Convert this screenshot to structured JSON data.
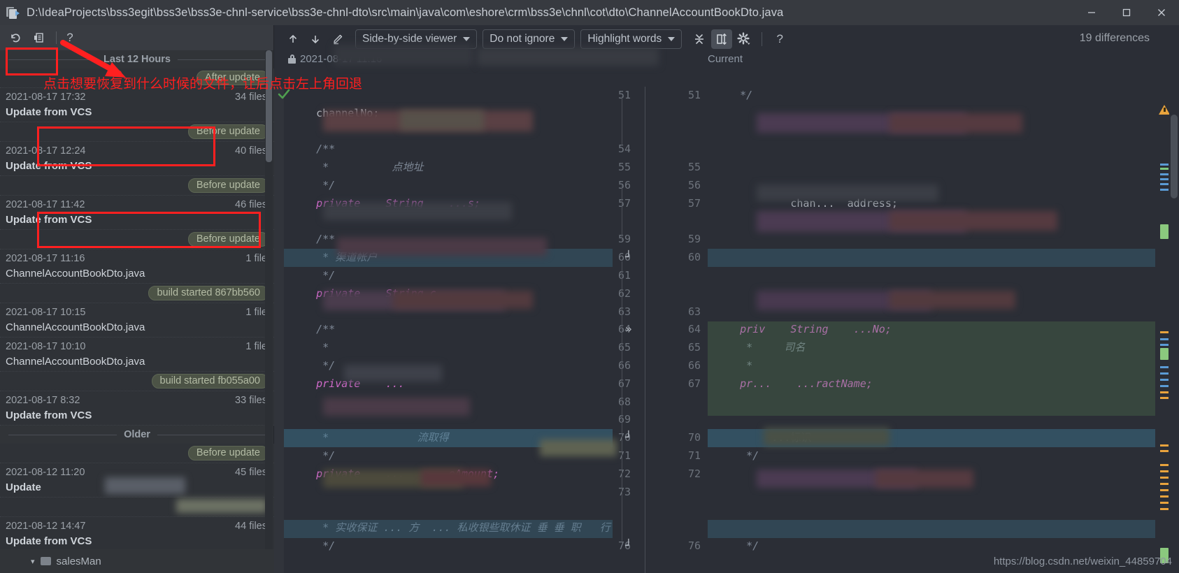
{
  "window": {
    "title": "D:\\IdeaProjects\\bss3egit\\bss3e\\bss3e-chnl-service\\bss3e-chnl-dto\\src\\main\\java\\com\\eshore\\crm\\bss3e\\chnl\\cot\\dto\\ChannelAccountBookDto.java",
    "minimize": "–",
    "maximize": "□",
    "close": "✕"
  },
  "local_history": {
    "toolbar": {
      "revert_tooltip": "Revert",
      "create_patch_tooltip": "Create Patch",
      "help_label": "?"
    },
    "groups": [
      {
        "label": "Last 12 Hours"
      },
      {
        "label": "Older"
      }
    ],
    "entries": [
      {
        "type": "tag",
        "tag": "After update"
      },
      {
        "type": "rev",
        "date": "2021-08-17 17:32",
        "files": "34 files",
        "label": "Update from VCS"
      },
      {
        "type": "tag",
        "tag": "Before update"
      },
      {
        "type": "rev",
        "date": "2021-08-17 12:24",
        "files": "40 files",
        "label": "Update from VCS"
      },
      {
        "type": "tag",
        "tag": "Before update"
      },
      {
        "type": "rev",
        "date": "2021-08-17 11:42",
        "files": "46 files",
        "label": "Update from VCS"
      },
      {
        "type": "tag",
        "tag": "Before update"
      },
      {
        "type": "rev",
        "date": "2021-08-17 11:16",
        "files": "1 file",
        "label": "ChannelAccountBookDto.java",
        "plain": true
      },
      {
        "type": "tag",
        "tag": "build started 867bb560"
      },
      {
        "type": "rev",
        "date": "2021-08-17 10:15",
        "files": "1 file",
        "label": "ChannelAccountBookDto.java",
        "plain": true
      },
      {
        "type": "rev",
        "date": "2021-08-17 10:10",
        "files": "1 file",
        "label": "ChannelAccountBookDto.java",
        "plain": true
      },
      {
        "type": "tag",
        "tag": "build started fb055a00"
      },
      {
        "type": "rev",
        "date": "2021-08-17 8:32",
        "files": "33 files",
        "label": "Update from VCS"
      },
      {
        "type": "group",
        "label": "Older"
      },
      {
        "type": "tag",
        "tag": "Before update"
      },
      {
        "type": "rev",
        "date": "2021-08-12 11:20",
        "files": "45 files",
        "label": "Update"
      },
      {
        "type": "tag",
        "tag": ""
      },
      {
        "type": "rev",
        "date": "2021-08-12 14:47",
        "files": "44 files",
        "label": "Update from VCS"
      },
      {
        "type": "tag",
        "tag": "Before update"
      }
    ],
    "tree_item": "salesMan"
  },
  "diff": {
    "toolbar": {
      "prev_diff_icon": "arrow-up-icon",
      "next_diff_icon": "arrow-down-icon",
      "edit_icon": "pencil-icon",
      "viewer_mode": "Side-by-side viewer",
      "whitespace_mode": "Do not ignore",
      "highlight_mode": "Highlight words",
      "collapse_unchanged_icon": "collapse-icon",
      "synchronize_icon": "sync-scroll-icon",
      "settings_icon": "gear-icon",
      "help_label": "?"
    },
    "difference_count": "19 differences",
    "left_header": "2021-08-17 11:16",
    "right_header": "Current",
    "left_line_numbers": [
      "51",
      "",
      "",
      "54",
      "55",
      "56",
      "57",
      "",
      "59",
      "60",
      "61",
      "62",
      "63",
      "64",
      "65",
      "66",
      "67",
      "68",
      "69",
      "70",
      "71",
      "72",
      "73",
      "",
      "",
      "76"
    ],
    "right_line_numbers": [
      "51",
      "",
      "",
      "",
      "55",
      "56",
      "57",
      "",
      "59",
      "60",
      "",
      "",
      "63",
      "64",
      "65",
      "66",
      "67",
      "",
      "",
      "70",
      "71",
      "72",
      "",
      "",
      "",
      "76"
    ],
    "left_code": [
      {
        "line": "51",
        "text": ""
      },
      {
        "line": "",
        "text": "    channelNo;"
      },
      {
        "line": "",
        "text": ""
      },
      {
        "line": "54",
        "text": "    /**"
      },
      {
        "line": "55",
        "text": "     *          点地址"
      },
      {
        "line": "56",
        "text": "     */"
      },
      {
        "line": "57",
        "text": "    private    String    ...s;"
      },
      {
        "line": "",
        "text": ""
      },
      {
        "line": "59",
        "text": "    /**"
      },
      {
        "line": "60",
        "text": "     * 渠道帐户"
      },
      {
        "line": "61",
        "text": "     */"
      },
      {
        "line": "62",
        "text": "    private    String c..."
      },
      {
        "line": "63",
        "text": ""
      },
      {
        "line": "64",
        "text": "    /**"
      },
      {
        "line": "65",
        "text": "     *"
      },
      {
        "line": "66",
        "text": "     */"
      },
      {
        "line": "67",
        "text": "    private    ..."
      },
      {
        "line": "68",
        "text": ""
      },
      {
        "line": "69",
        "text": ""
      },
      {
        "line": "70",
        "text": "     *              流取得"
      },
      {
        "line": "71",
        "text": "     */"
      },
      {
        "line": "72",
        "text": "    private    ...    ...eAmount;"
      },
      {
        "line": "73",
        "text": ""
      },
      {
        "line": "",
        "text": ""
      },
      {
        "line": "",
        "text": "     * 实收保证 ... 方  ... 私收银些取休证 垂 垂 职   行"
      },
      {
        "line": "76",
        "text": "     */"
      }
    ],
    "right_code": [
      {
        "line": "51",
        "text": "    */"
      },
      {
        "line": "",
        "text": ""
      },
      {
        "line": "",
        "text": ""
      },
      {
        "line": "",
        "text": ""
      },
      {
        "line": "55",
        "text": ""
      },
      {
        "line": "56",
        "text": ""
      },
      {
        "line": "57",
        "text": "            chan...  address;"
      },
      {
        "line": "",
        "text": ""
      },
      {
        "line": "59",
        "text": ""
      },
      {
        "line": "60",
        "text": ""
      },
      {
        "line": "",
        "text": ""
      },
      {
        "line": "",
        "text": ""
      },
      {
        "line": "63",
        "text": ""
      },
      {
        "line": "64",
        "text": "    priv    String    ...No;"
      },
      {
        "line": "65",
        "text": "     *     司名"
      },
      {
        "line": "66",
        "text": "     *"
      },
      {
        "line": "67",
        "text": "    pr...    ...ractName;"
      },
      {
        "line": "",
        "text": ""
      },
      {
        "line": "",
        "text": ""
      },
      {
        "line": "70",
        "text": "         ...标识"
      },
      {
        "line": "71",
        "text": "     */"
      },
      {
        "line": "72",
        "text": ""
      },
      {
        "line": "",
        "text": ""
      },
      {
        "line": "",
        "text": ""
      },
      {
        "line": "",
        "text": ""
      },
      {
        "line": "76",
        "text": "     */"
      }
    ],
    "change_markers": [
      {
        "row": 9,
        "glyph": "┘",
        "kind": "modified"
      },
      {
        "row": 13,
        "glyph": "»",
        "kind": "added"
      },
      {
        "row": 19,
        "glyph": "┘",
        "kind": "modified"
      },
      {
        "row": 25,
        "glyph": "┘",
        "kind": "modified"
      }
    ]
  },
  "annotations": {
    "note_top": "点击想要恢复到什么时候的文件，让后点击左上角回退",
    "arrow_icon": "red-arrow-icon",
    "box_toolbar": "revert-toolbar-highlight",
    "box_rev1": "revision-2021-08-17-12-24-highlight",
    "box_rev2": "revision-2021-08-17-11-16-highlight"
  },
  "watermark": "https://blog.csdn.net/weixin_44859704",
  "colors": {
    "accent_red": "#ff2020",
    "added_green": "#537e53",
    "modified_blue": "#3c6e87",
    "warning_orange": "#e8a33d",
    "tag_green": "#b3bba4"
  }
}
